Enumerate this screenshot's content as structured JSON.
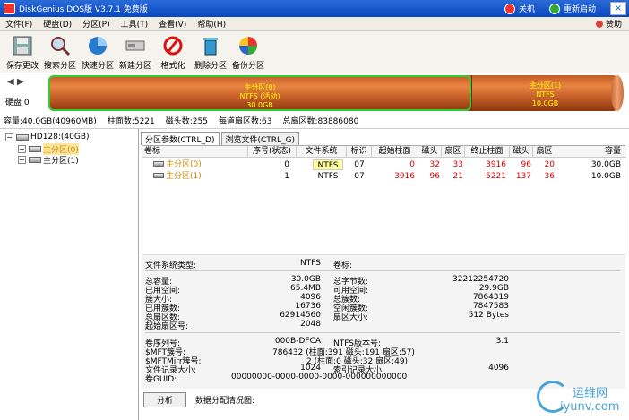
{
  "title": "DiskGenius DOS版 V3.7.1 免费版",
  "titlebar": {
    "shutdown": "关机",
    "restart": "重新启动",
    "close": "×"
  },
  "menu": [
    "文件(F)",
    "硬盘(D)",
    "分区(P)",
    "工具(T)",
    "查看(V)",
    "帮助(H)"
  ],
  "donate": "赞助",
  "tools": [
    "保存更改",
    "搜索分区",
    "快速分区",
    "新建分区",
    "格式化",
    "删除分区",
    "备份分区"
  ],
  "disk": {
    "label": "硬盘 0",
    "seg0": {
      "name": "主分区(0)",
      "fs": "NTFS (活动)",
      "size": "30.0GB"
    },
    "seg1": {
      "name": "主分区(1)",
      "fs": "NTFS",
      "size": "10.0GB"
    }
  },
  "diskinfo": [
    "容量:40.0GB(40960MB)",
    "柱面数:5221",
    "磁头数:255",
    "每道扇区数:63",
    "总扇区数:83886080"
  ],
  "tree": {
    "root": "HD128:(40GB)",
    "p0": "主分区(0)",
    "p1": "主分区(1)"
  },
  "tabs": [
    "分区参数(CTRL_D)",
    "浏览文件(CTRL_G)"
  ],
  "columns": [
    "卷标",
    "序号(状态)",
    "文件系统",
    "标识",
    "起始柱面",
    "磁头",
    "扇区",
    "终止柱面",
    "磁头",
    "扇区",
    "容量"
  ],
  "rows": [
    [
      "主分区(0)",
      "0",
      "NTFS",
      "07",
      "0",
      "32",
      "33",
      "3916",
      "96",
      "20",
      "30.0GB"
    ],
    [
      "主分区(1)",
      "1",
      "NTFS",
      "07",
      "3916",
      "96",
      "21",
      "5221",
      "137",
      "36",
      "10.0GB"
    ]
  ],
  "details": {
    "fstype_label": "文件系统类型:",
    "fstype": "NTFS",
    "vol_label": "卷标:",
    "left": [
      [
        "总容量:",
        "30.0GB"
      ],
      [
        "已用空间:",
        "65.4MB"
      ],
      [
        "簇大小:",
        "4096"
      ],
      [
        "已用簇数:",
        "16736"
      ],
      [
        "总扇区数:",
        "62914560"
      ],
      [
        "起始扇区号:",
        "2048"
      ]
    ],
    "right": [
      [
        "总字节数:",
        "32212254720"
      ],
      [
        "可用空间:",
        "29.9GB"
      ],
      [
        "总簇数:",
        "7864319"
      ],
      [
        "空闲簇数:",
        "7847583"
      ],
      [
        "扇区大小:",
        "512 Bytes"
      ]
    ],
    "serial_label": "卷序列号:",
    "serial": "000B-DFCA",
    "ntfsver_label": "NTFS版本号:",
    "ntfsver": "3.1",
    "mft_label": "$MFT簇号:",
    "mft": "786432 (柱面:391 磁头:191 扇区:57)",
    "mftmirr_label": "$MFTMirr簇号:",
    "mftmirr": "2 (柱面:0 磁头:32 扇区:49)",
    "frs_label": "文件记录大小:",
    "frs": "1024",
    "idx_label": "索引记录大小:",
    "idx": "4096",
    "guid_label": "卷GUID:",
    "guid": "00000000-0000-0000-0000-000000000000"
  },
  "bottom": {
    "analyze": "分析",
    "alloc_label": "数据分配情况图:"
  },
  "watermark": {
    "cn": "运维网",
    "en": "iyunv.com"
  }
}
